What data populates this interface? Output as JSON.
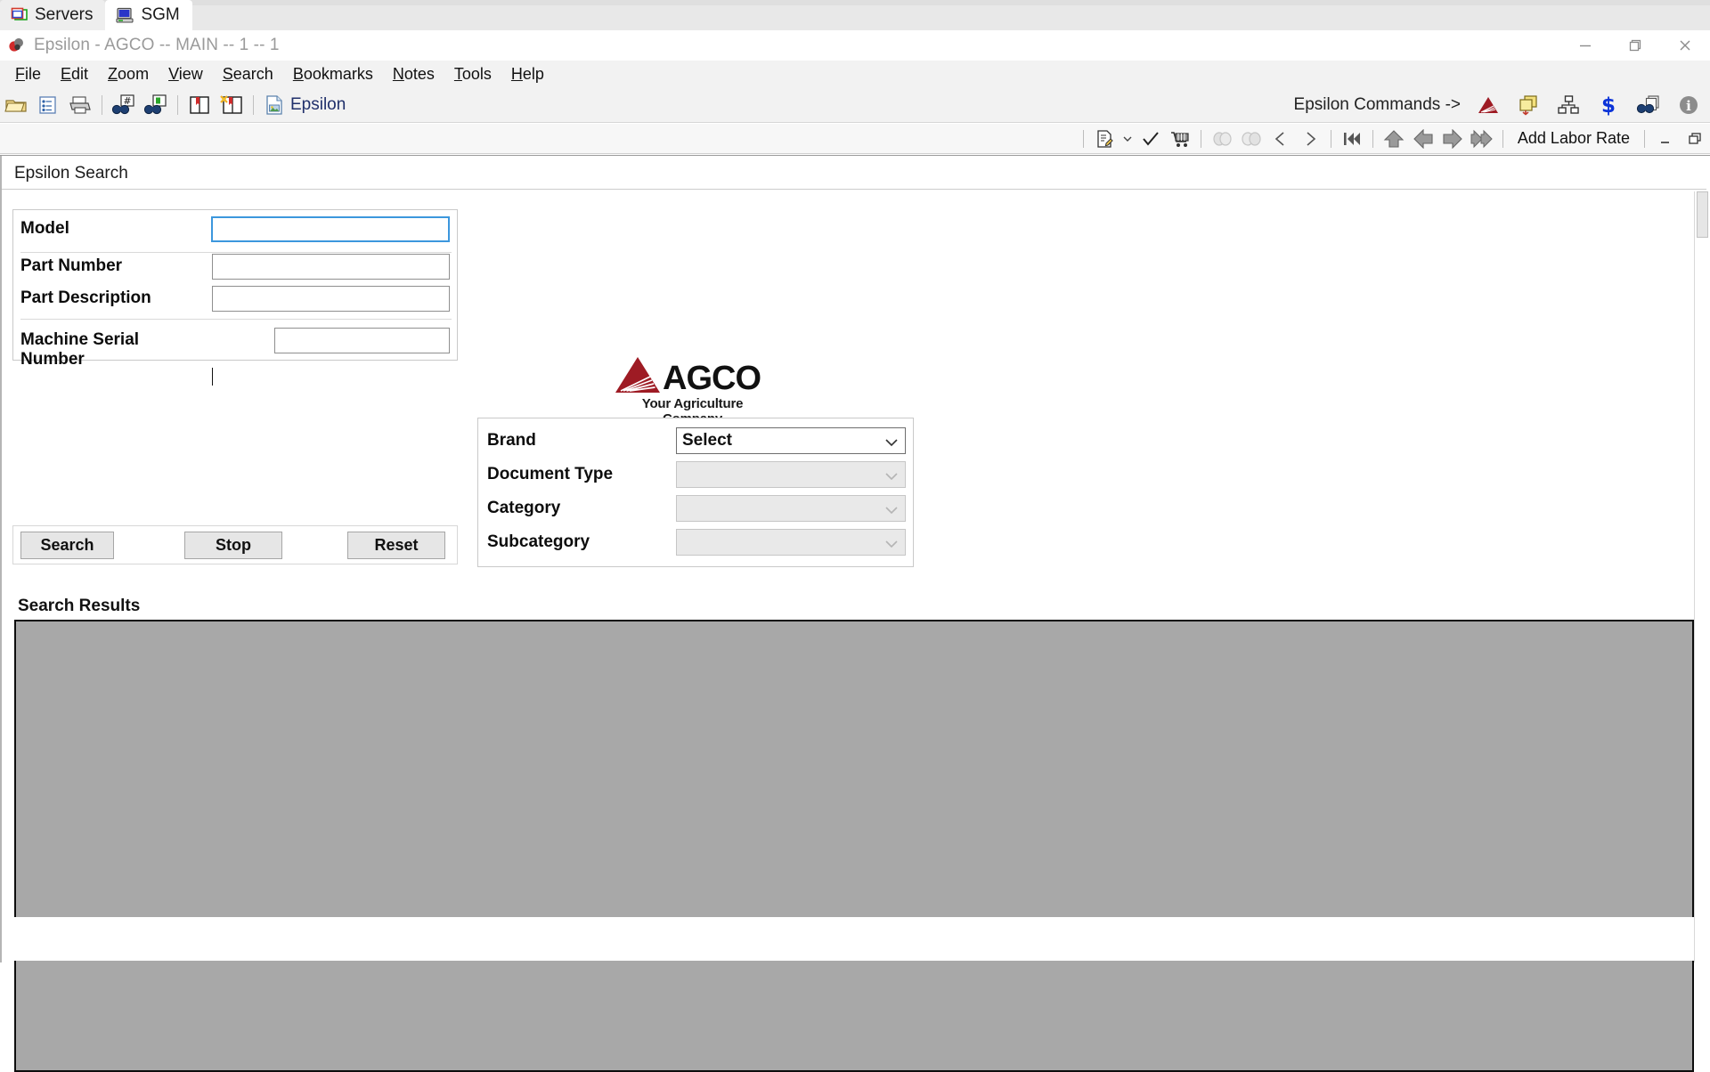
{
  "tabs": [
    {
      "label": "Servers",
      "icon": "windows-overlap-icon",
      "active": false
    },
    {
      "label": "SGM",
      "icon": "computer-monitor-icon",
      "active": true
    }
  ],
  "window": {
    "title": "Epsilon - AGCO -- MAIN -- 1 -- 1",
    "app_icon": "epsilon-app-icon",
    "controls": [
      {
        "name": "minimize-button",
        "glyph": "—"
      },
      {
        "name": "restore-button",
        "glyph": "restore-icon"
      },
      {
        "name": "close-button",
        "glyph": "✕"
      }
    ]
  },
  "menu": {
    "items": [
      {
        "label": "File",
        "accel": "F"
      },
      {
        "label": "Edit",
        "accel": "E"
      },
      {
        "label": "Zoom",
        "accel": "Z"
      },
      {
        "label": "View",
        "accel": "V"
      },
      {
        "label": "Search",
        "accel": "S"
      },
      {
        "label": "Bookmarks",
        "accel": "B"
      },
      {
        "label": "Notes",
        "accel": "N"
      },
      {
        "label": "Tools",
        "accel": "T"
      },
      {
        "label": "Help",
        "accel": "H"
      }
    ]
  },
  "toolbar_primary": {
    "buttons": [
      {
        "name": "open-folder-icon",
        "title": "Open"
      },
      {
        "name": "document-tree-icon",
        "title": "Document Tree"
      },
      {
        "name": "printer-icon",
        "title": "Print"
      },
      {
        "name": "find-number-icon",
        "title": "Find Number"
      },
      {
        "name": "find-page-icon",
        "title": "Find Page"
      },
      {
        "name": "bookmark-book-icon",
        "title": "Bookmarks"
      },
      {
        "name": "notes-book-icon",
        "title": "Notes"
      },
      {
        "name": "page-image-icon",
        "title": "Epsilon"
      }
    ],
    "combo_label": "Epsilon",
    "combo_dropdown": "chevron-down-icon",
    "commands_label": "Epsilon Commands ->",
    "command_icons": [
      {
        "name": "agco-triangle-icon"
      },
      {
        "name": "copy-pages-icon"
      },
      {
        "name": "hierarchy-icon"
      },
      {
        "name": "dollar-icon"
      },
      {
        "name": "find-stack-icon"
      },
      {
        "name": "info-icon"
      }
    ]
  },
  "toolbar_secondary": {
    "buttons": [
      {
        "name": "edit-document-icon"
      },
      {
        "name": "chevron-down-icon"
      },
      {
        "name": "check-icon"
      },
      {
        "name": "shopping-cart-icon"
      },
      {
        "name": "masks-dim-icon"
      },
      {
        "name": "masks-dim2-icon"
      },
      {
        "name": "prev-triangle-icon"
      },
      {
        "name": "next-triangle-icon"
      },
      {
        "name": "first-track-icon"
      },
      {
        "name": "up-arrow-icon"
      },
      {
        "name": "left-arrow-icon"
      },
      {
        "name": "right-arrow-icon"
      },
      {
        "name": "fast-forward-icon"
      }
    ],
    "labor_rate_label": "Add Labor Rate",
    "minimize_glyph": "_",
    "restore_glyph": "restore-small-icon"
  },
  "panel": {
    "title": "Epsilon Search"
  },
  "search_form": {
    "fields": [
      {
        "label": "Model",
        "value": "",
        "focused": true,
        "name": "model-input"
      },
      {
        "label": "Part Number",
        "value": "",
        "focused": false,
        "name": "part-number-input"
      },
      {
        "label": "Part Description",
        "value": "",
        "focused": false,
        "name": "part-description-input"
      },
      {
        "label": "Machine Serial Number",
        "value": "",
        "focused": false,
        "name": "machine-serial-number-input"
      }
    ]
  },
  "buttons": [
    {
      "label": "Search",
      "name": "search-button"
    },
    {
      "label": "Stop",
      "name": "stop-button"
    },
    {
      "label": "Reset",
      "name": "reset-button"
    }
  ],
  "logo": {
    "word": "AGCO",
    "tagline": "Your Agriculture Company",
    "triangle_color": "#9e1b24"
  },
  "filters": [
    {
      "label": "Brand",
      "value": "Select",
      "enabled": true,
      "name": "brand-select"
    },
    {
      "label": "Document Type",
      "value": "",
      "enabled": false,
      "name": "document-type-select"
    },
    {
      "label": "Category",
      "value": "",
      "enabled": false,
      "name": "category-select"
    },
    {
      "label": "Subcategory",
      "value": "",
      "enabled": false,
      "name": "subcategory-select"
    }
  ],
  "results": {
    "label": "Search Results",
    "rows": []
  },
  "colors": {
    "accent": "#9e1b24",
    "focus_border": "#3c97dd",
    "results_bg": "#a8a8a8",
    "toolbar_bg": "#f2f2f2"
  }
}
